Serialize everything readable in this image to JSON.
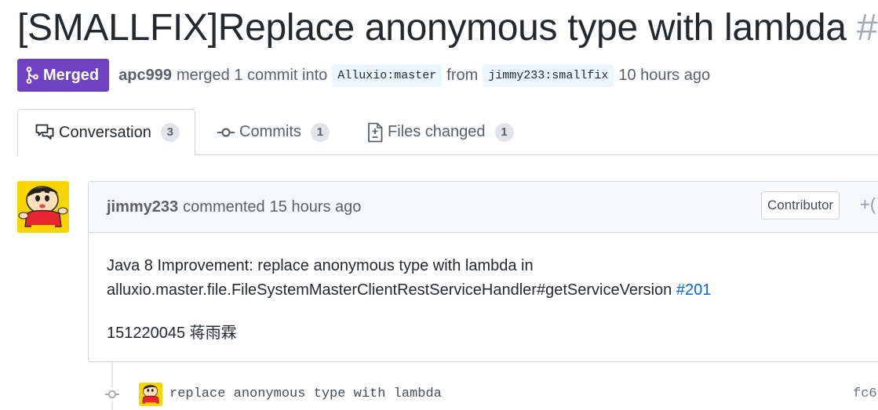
{
  "title": {
    "text": "[SMALLFIX]Replace anonymous type with lambda",
    "number": "#"
  },
  "meta": {
    "state": "Merged",
    "author": "apc999",
    "action": "merged 1 commit into",
    "base_branch": "Alluxio:master",
    "from": "from",
    "head_branch": "jimmy233:smallfix",
    "ago": "10 hours ago"
  },
  "tabs": [
    {
      "label": "Conversation",
      "count": "3",
      "icon": "comment-discussion-icon"
    },
    {
      "label": "Commits",
      "count": "1",
      "icon": "git-commit-icon"
    },
    {
      "label": "Files changed",
      "count": "1",
      "icon": "file-diff-icon"
    }
  ],
  "comment": {
    "author": "jimmy233",
    "action": "commented",
    "ago": "15 hours ago",
    "role": "Contributor",
    "react": "+(",
    "body_line1": "Java 8 Improvement: replace anonymous type with lambda in",
    "body_line2": "alluxio.master.file.FileSystemMasterClientRestServiceHandler#getServiceVersion",
    "issue_link": "#201",
    "body_line3": "151220045 蒋雨霖"
  },
  "commit": {
    "message": "replace anonymous type with lambda",
    "sha": "fc6"
  },
  "colors": {
    "merged": "#6f42c1",
    "link": "#0366d6",
    "avatar_bg": "#f8d500"
  }
}
